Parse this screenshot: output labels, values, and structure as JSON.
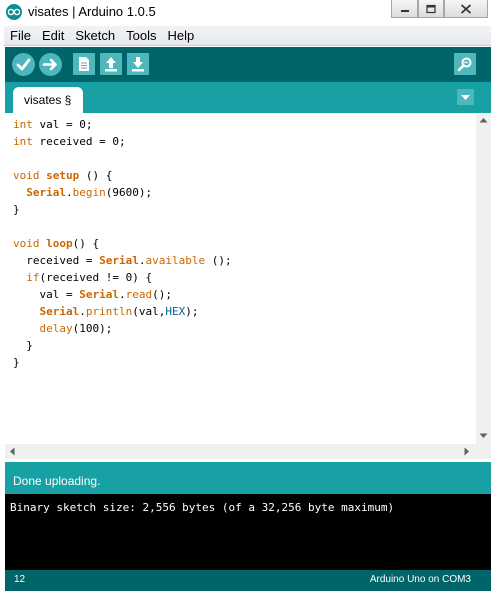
{
  "window": {
    "title": "visates | Arduino 1.0.5",
    "controls": [
      "minimize",
      "maximize",
      "close"
    ]
  },
  "menu": {
    "items": [
      {
        "label": "File"
      },
      {
        "label": "Edit"
      },
      {
        "label": "Sketch"
      },
      {
        "label": "Tools"
      },
      {
        "label": "Help"
      }
    ]
  },
  "toolbar": {
    "buttons": [
      "verify-icon",
      "upload-arrow-icon",
      "new-file-icon",
      "open-arrow-up-icon",
      "save-arrow-down-icon"
    ],
    "right_button": "serial-monitor-icon"
  },
  "tabs": {
    "active": "visates §"
  },
  "editor": {
    "lines": [
      [
        {
          "t": "int",
          "c": "kw"
        },
        {
          "t": " val = 0;"
        }
      ],
      [
        {
          "t": "int",
          "c": "kw"
        },
        {
          "t": " received = 0;"
        }
      ],
      [
        {
          "t": ""
        }
      ],
      [
        {
          "t": "void",
          "c": "kw"
        },
        {
          "t": " "
        },
        {
          "t": "setup",
          "c": "kwb"
        },
        {
          "t": " () {"
        }
      ],
      [
        {
          "t": "  "
        },
        {
          "t": "Serial",
          "c": "kwb"
        },
        {
          "t": "."
        },
        {
          "t": "begin",
          "c": "kw"
        },
        {
          "t": "(9600);"
        }
      ],
      [
        {
          "t": "}"
        }
      ],
      [
        {
          "t": ""
        }
      ],
      [
        {
          "t": "void",
          "c": "kw"
        },
        {
          "t": " "
        },
        {
          "t": "loop",
          "c": "kwb"
        },
        {
          "t": "() {"
        }
      ],
      [
        {
          "t": "  received = "
        },
        {
          "t": "Serial",
          "c": "kwb"
        },
        {
          "t": "."
        },
        {
          "t": "available",
          "c": "kw"
        },
        {
          "t": " ();"
        }
      ],
      [
        {
          "t": "  "
        },
        {
          "t": "if",
          "c": "kw"
        },
        {
          "t": "(received != 0) {"
        }
      ],
      [
        {
          "t": "    val = "
        },
        {
          "t": "Serial",
          "c": "kwb"
        },
        {
          "t": "."
        },
        {
          "t": "read",
          "c": "kw"
        },
        {
          "t": "();"
        }
      ],
      [
        {
          "t": "    "
        },
        {
          "t": "Serial",
          "c": "kwb"
        },
        {
          "t": "."
        },
        {
          "t": "println",
          "c": "kw"
        },
        {
          "t": "(val,"
        },
        {
          "t": "HEX",
          "c": "cn"
        },
        {
          "t": ");"
        }
      ],
      [
        {
          "t": "    "
        },
        {
          "t": "delay",
          "c": "kw"
        },
        {
          "t": "(100);"
        }
      ],
      [
        {
          "t": "  }"
        }
      ],
      [
        {
          "t": "}"
        }
      ]
    ]
  },
  "status": {
    "message": "Done uploading."
  },
  "console": {
    "text": "Binary sketch size: 2,556 bytes (of a 32,256 byte maximum)"
  },
  "footer": {
    "line_number": "12",
    "board": "Arduino Uno on COM3"
  },
  "colors": {
    "toolbar": "#006468",
    "tabbar": "#17a1a5",
    "button": "#4db7bb",
    "keyword": "#cc6600",
    "constant": "#006699",
    "console_bg": "#000000"
  }
}
